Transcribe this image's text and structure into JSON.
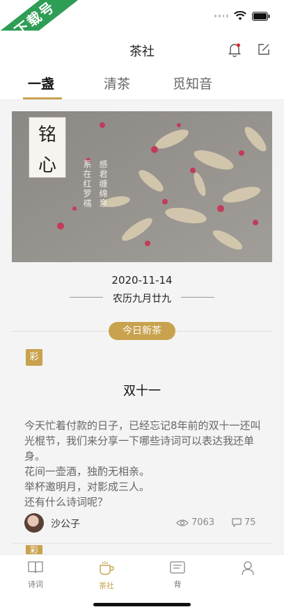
{
  "watermark": "下载号",
  "nav": {
    "title": "茶社"
  },
  "tabs": [
    {
      "label": "一盏"
    },
    {
      "label": "清茶"
    },
    {
      "label": "觅知音"
    }
  ],
  "hero": {
    "card_chars": [
      "铭",
      "心"
    ],
    "poem_cols": [
      "感君缠绵意",
      "系在红罗襦"
    ]
  },
  "date": "2020-11-14",
  "lunar": "农历九月廿九",
  "today_badge": "今日新茶",
  "post": {
    "tag": "彩",
    "title": "双十一",
    "body_lines": [
      "今天忙着付款的日子，已经忘记8年前的双十一还叫光棍节，我们来分享一下哪些诗词可以表达我还单身。",
      "花间一壶酒，独酌无相亲。",
      "举杯邀明月，对影成三人。",
      "还有什么诗词呢？"
    ],
    "author": "沙公子",
    "views": "7063",
    "comments": "75"
  },
  "next_tag": "彩",
  "bottom_nav": [
    {
      "label": "诗词",
      "icon": "book-icon"
    },
    {
      "label": "茶社",
      "icon": "teacup-icon"
    },
    {
      "label": "背",
      "icon": "card-icon"
    },
    {
      "label": "",
      "icon": "profile-icon"
    }
  ],
  "colors": {
    "accent": "#c8a24e",
    "ribbon": "#2e9d55"
  }
}
